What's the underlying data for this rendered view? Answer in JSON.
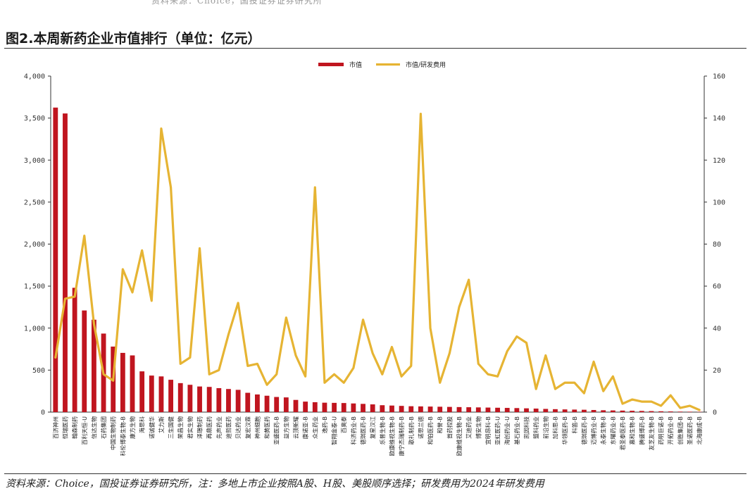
{
  "header": {
    "top_cut_text": "资料来源：Choice，国投证券证券研究所",
    "title": "图2.本周新药企业市值排行（单位：亿元）"
  },
  "footer": {
    "source": "资料来源：Choice，国投证券证券研究所，注：多地上市企业按照A股、H股、美股顺序选择；研发费用为2024年研发费用"
  },
  "colors": {
    "bar": "#c0151f",
    "line": "#e6b433",
    "axis": "#333333"
  },
  "chart_data": {
    "type": "bar",
    "legend": {
      "placement": "top-center",
      "entries": [
        "市值",
        "市值/研发费用"
      ]
    },
    "y_left": {
      "min": 0,
      "max": 4000,
      "ticks": [
        "0",
        "500",
        "1,000",
        "1,500",
        "2,000",
        "2,500",
        "3,000",
        "3,500",
        "4,000"
      ]
    },
    "y_right": {
      "min": 0,
      "max": 160,
      "ticks": [
        "0",
        "20",
        "40",
        "60",
        "80",
        "100",
        "120",
        "140",
        "160"
      ]
    },
    "grid": false,
    "categories": [
      "百济神州",
      "恒瑞医药",
      "翰森制药",
      "百利天恒-U",
      "信达生物",
      "石药集团",
      "中国生物制药",
      "科伦博泰生物-B",
      "康方生物",
      "海思科",
      "诺诚健华",
      "艾力斯",
      "三生国健",
      "荣昌生物",
      "君实生物",
      "泽璟制药",
      "再鼎医药",
      "先声药业",
      "迪哲医药",
      "贝达药业",
      "复宏汉霖",
      "神州细胞",
      "和黄医药",
      "亚盛医药-B",
      "益方生物",
      "云顶新耀",
      "康诺亚-B",
      "众生药业",
      "逸药-B",
      "智翔金泰-U",
      "百奥泰",
      "科济药业-B",
      "德琪医药-B",
      "复星汉江",
      "乐普生物-B",
      "欧康维视生物-B",
      "康宁杰瑞制药-B",
      "歌礼制药-B",
      "诺思兰德",
      "和铂医药-B",
      "和誉-B",
      "首药控股",
      "欧康维视生物-B",
      "艾迪药业",
      "博安生物",
      "宜明昂科-B",
      "亚虹医药-U",
      "海创药业-U",
      "基石药业-B",
      "凯因科技",
      "盟科药业",
      "前沿生物",
      "加科思-B",
      "华领医药-B",
      "科笛-B",
      "德琪医药-B",
      "迈博药业-B",
      "永泰生物-B",
      "东曜药业-B",
      "君圣泰医药-B",
      "嘉和生物-B",
      "腾盛博药-B",
      "友芝友生物-B",
      "药明巨诺-B",
      "开拓药业-B",
      "创胜集团-B",
      "圣诺医药-B",
      "北海康成-B"
    ],
    "series": [
      {
        "name": "市值",
        "axis": "left",
        "values": [
          3625,
          3555,
          1480,
          1210,
          1100,
          935,
          780,
          705,
          675,
          485,
          435,
          425,
          385,
          345,
          325,
          305,
          300,
          285,
          275,
          265,
          230,
          210,
          195,
          180,
          175,
          145,
          125,
          118,
          112,
          110,
          108,
          103,
          98,
          92,
          82,
          78,
          74,
          70,
          68,
          66,
          64,
          62,
          60,
          58,
          56,
          54,
          52,
          50,
          48,
          45,
          42,
          38,
          35,
          32,
          30,
          28,
          25,
          22,
          20,
          18,
          16,
          14,
          12,
          10,
          8,
          6,
          5,
          4
        ]
      },
      {
        "name": "市值/研发费用",
        "axis": "right",
        "values": [
          26,
          54,
          55,
          84,
          42,
          18,
          15,
          68,
          57,
          77,
          53,
          135,
          107,
          23,
          26,
          78,
          18,
          20,
          37,
          52,
          22,
          23,
          13,
          18,
          45,
          27,
          17,
          107,
          14,
          18,
          14,
          21,
          44,
          28,
          18,
          31,
          17,
          22,
          142,
          40,
          14,
          28,
          50,
          63,
          23,
          18,
          17,
          29,
          36,
          33,
          11,
          27,
          11,
          14,
          14,
          9,
          24,
          10,
          17,
          4,
          6,
          5,
          5,
          3,
          8,
          2,
          3,
          1
        ]
      }
    ]
  }
}
